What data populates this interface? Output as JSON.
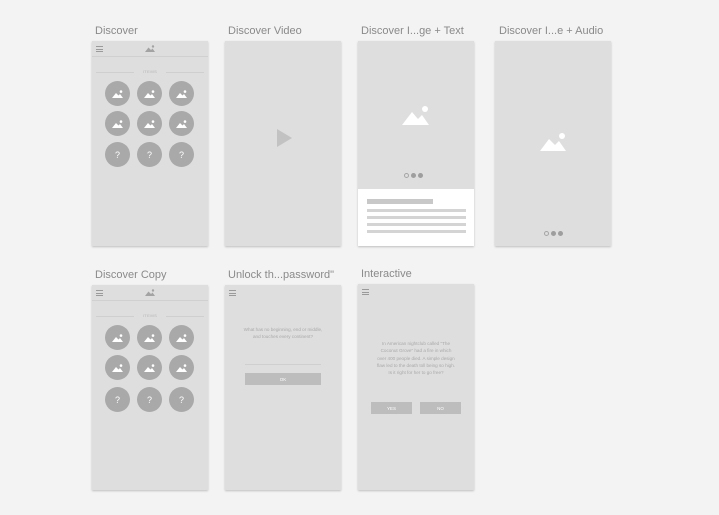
{
  "artboards": {
    "discover": {
      "title": "Discover",
      "section_label": "ITEMS",
      "unknown_glyph": "?"
    },
    "discover_video": {
      "title": "Discover Video"
    },
    "discover_image_text": {
      "title": "Discover I...ge + Text"
    },
    "discover_image_audio": {
      "title": "Discover I...e + Audio"
    },
    "discover_copy": {
      "title": "Discover Copy",
      "section_label": "ITEMS",
      "unknown_glyph": "?"
    },
    "unlock": {
      "title": "Unlock th...password\"",
      "riddle_lines": [
        "What has no beginning, end or middle,",
        "and touches every continent?"
      ],
      "button_label": "OK"
    },
    "interactive": {
      "title": "Interactive",
      "story_lines": [
        "In American nightclub called \"The",
        "Coconut Grove\" had a fire in which",
        "over 400 people died. A simple design",
        "flaw led to the death toll being so high.",
        "Is it right for her to go free?"
      ],
      "yes_label": "YES",
      "no_label": "NO"
    }
  },
  "colors": {
    "canvas": "#f3f3f3",
    "artboard_fill": "#dedede",
    "placeholder_circle": "#a9a9a9",
    "title_text": "#8a8a8a"
  }
}
